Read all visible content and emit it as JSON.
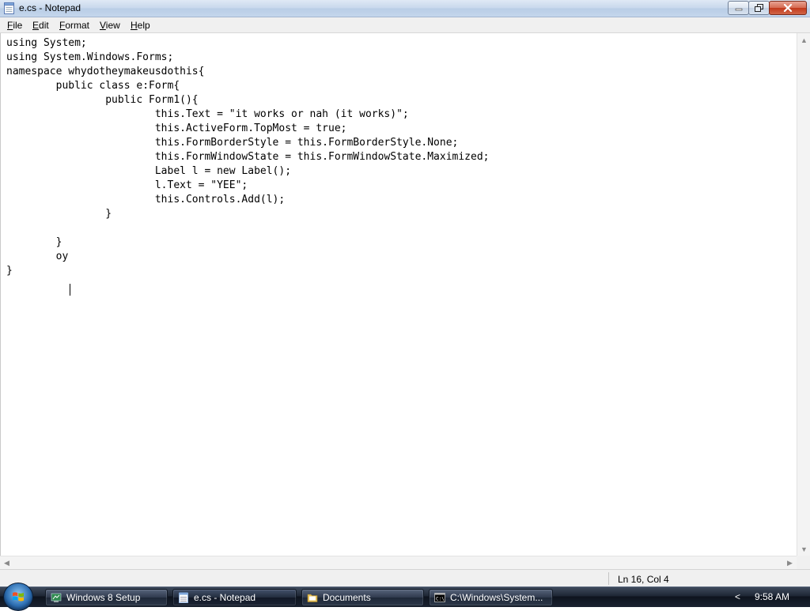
{
  "window": {
    "title": "e.cs - Notepad",
    "icon": "notepad-icon"
  },
  "caption_buttons": {
    "minimize_icon": "minimize-icon",
    "maximize_icon": "restore-icon",
    "close_icon": "close-icon"
  },
  "menu": {
    "items": [
      {
        "ul": "F",
        "rest": "ile"
      },
      {
        "ul": "E",
        "rest": "dit"
      },
      {
        "ul": "F",
        "rest": "ormat"
      },
      {
        "ul": "V",
        "rest": "iew"
      },
      {
        "ul": "H",
        "rest": "elp"
      }
    ]
  },
  "editor": {
    "text": "using System;\nusing System.Windows.Forms;\nnamespace whydotheymakeusdothis{\n\tpublic class e:Form{\n\t\tpublic Form1(){\n\t\t\tthis.Text = \"it works or nah (it works)\";\n\t\t\tthis.ActiveForm.TopMost = true;\n\t\t\tthis.FormBorderStyle = this.FormBorderStyle.None;\n\t\t\tthis.FormWindowState = this.FormWindowState.Maximized;\n\t\t\tLabel l = new Label();\n\t\t\tl.Text = \"YEE\";\n\t\t\tthis.Controls.Add(l);\n\t\t}\n\n\t}\n\toy\n}"
  },
  "statusbar": {
    "position": "Ln 16, Col 4"
  },
  "taskbar": {
    "start_icon": "windows-start-icon",
    "items": [
      {
        "label": "Windows 8 Setup",
        "icon": "setup-icon",
        "active": false
      },
      {
        "label": "e.cs - Notepad",
        "icon": "notepad-icon",
        "active": true
      },
      {
        "label": "Documents",
        "icon": "folder-icon",
        "active": false
      },
      {
        "label": "C:\\Windows\\System...",
        "icon": "cmd-icon",
        "active": false
      }
    ],
    "tray_arrow": "<",
    "clock": "9:58 AM"
  },
  "colors": {
    "titlebar": "#c7d7ec",
    "taskbar": "#1d2533",
    "close_button": "#c2391c"
  }
}
